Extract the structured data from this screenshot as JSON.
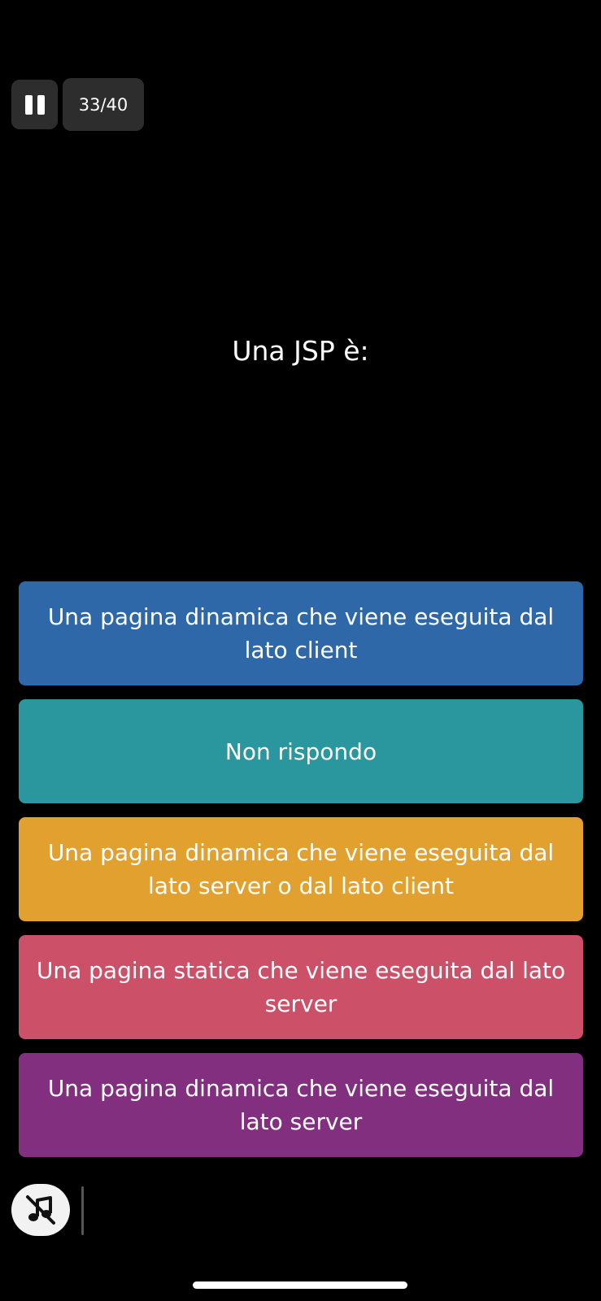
{
  "header": {
    "pause_icon": "pause-icon",
    "counter": "33/40"
  },
  "question": {
    "text": "Una JSP è:"
  },
  "answers": [
    {
      "label": "Una pagina dinamica che viene eseguita dal lato client",
      "color": "#2e68a8"
    },
    {
      "label": "Non rispondo",
      "color": "#2a969e"
    },
    {
      "label": "Una pagina dinamica che viene eseguita dal lato server o dal lato client",
      "color": "#e2a02e"
    },
    {
      "label": "Una pagina statica che viene eseguita dal lato server",
      "color": "#cc5067"
    },
    {
      "label": "Una pagina dinamica che viene eseguita dal lato server",
      "color": "#822f80"
    }
  ],
  "footer": {
    "mute_icon": "music-off-icon"
  }
}
